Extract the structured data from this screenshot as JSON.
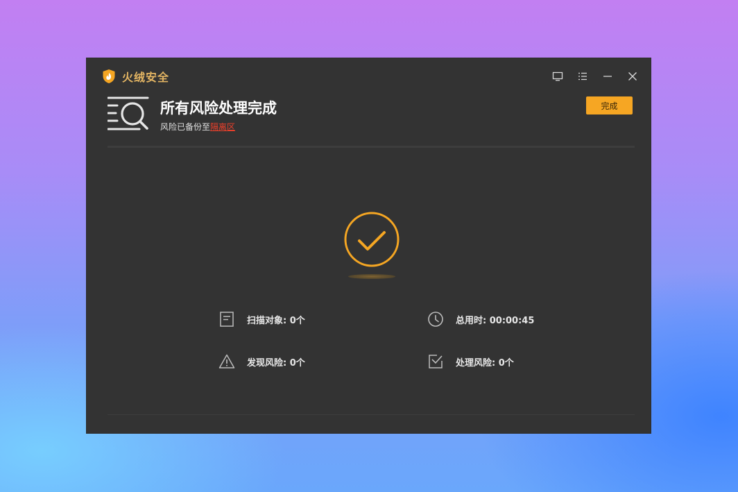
{
  "window": {
    "app_name": "火绒安全"
  },
  "header": {
    "title": "所有风险处理完成",
    "subtitle_prefix": "风险已备份至",
    "subtitle_link": "隔离区",
    "done_label": "完成"
  },
  "stats": {
    "scan_objects": "扫描对象: 0个",
    "total_time": "总用时: 00:00:45",
    "risks_found": "发现风险: 0个",
    "risks_handled": "处理风险: 0个"
  },
  "colors": {
    "accent": "#f6a623",
    "brand": "#e3b563",
    "link": "#f0402b",
    "window_bg": "#333333"
  },
  "icons": {
    "logo": "shield-flame-icon",
    "header": "scan-magnifier-icon",
    "status": "success-check-icon",
    "scan_objects": "document-icon",
    "total_time": "clock-icon",
    "risks_found": "warning-icon",
    "risks_handled": "checkbox-icon"
  }
}
